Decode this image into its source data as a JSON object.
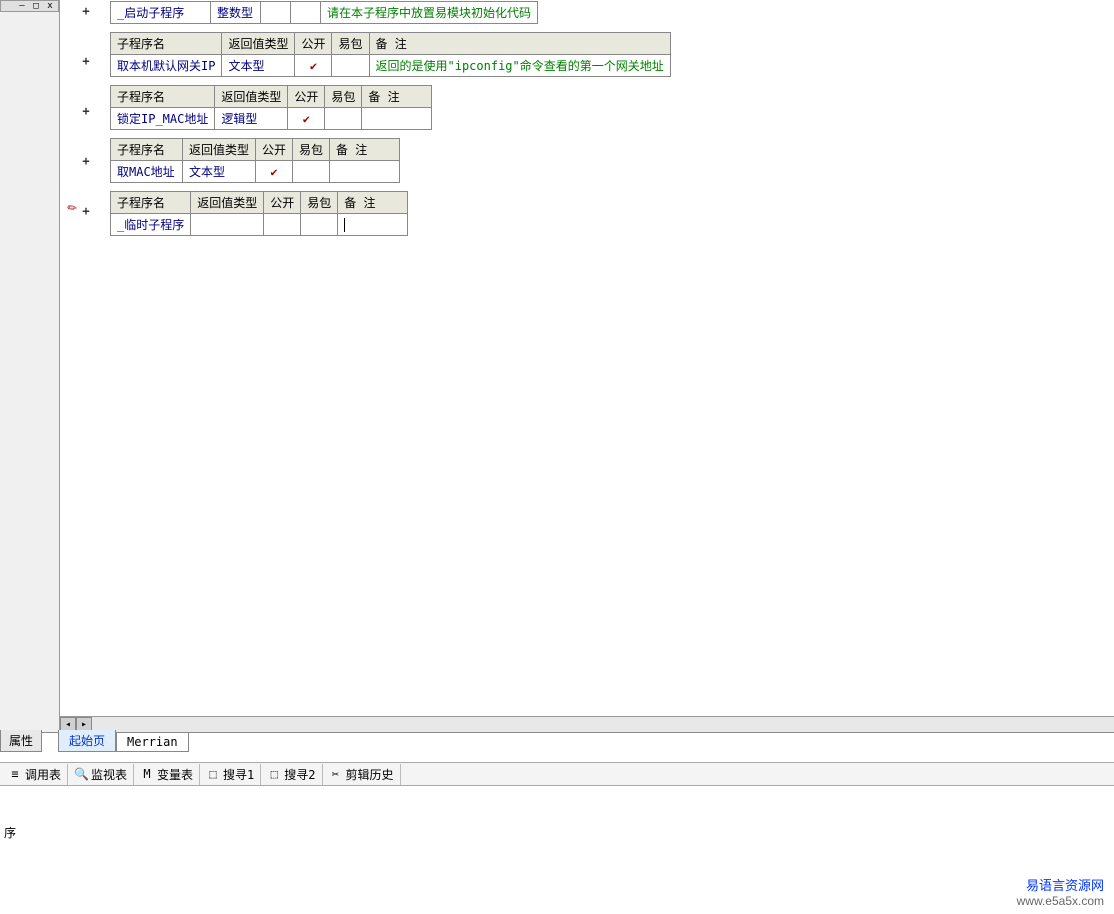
{
  "headers": {
    "name": "子程序名",
    "ret": "返回值类型",
    "pub": "公开",
    "pkg": "易包",
    "note": "备 注"
  },
  "subs": [
    {
      "name": "_启动子程序",
      "ret": "整数型",
      "pub": "",
      "pkg": "",
      "note": "请在本子程序中放置易模块初始化代码"
    },
    {
      "name": "取本机默认网关IP",
      "ret": "文本型",
      "pub": "✓",
      "pkg": "",
      "note": "返回的是使用\"ipconfig\"命令查看的第一个网关地址"
    },
    {
      "name": "锁定IP_MAC地址",
      "ret": "逻辑型",
      "pub": "✓",
      "pkg": "",
      "note": ""
    },
    {
      "name": "取MAC地址",
      "ret": "文本型",
      "pub": "✓",
      "pkg": "",
      "note": ""
    },
    {
      "name": "_临时子程序",
      "ret": "",
      "pub": "",
      "pkg": "",
      "note": "|"
    }
  ],
  "tabs": {
    "prop": "属性",
    "start": "起始页",
    "merrian": "Merrian"
  },
  "tools": [
    {
      "icon": "≡",
      "label": "调用表"
    },
    {
      "icon": "🔍",
      "label": "监视表"
    },
    {
      "icon": "M",
      "label": "变量表"
    },
    {
      "icon": "⬚",
      "label": "搜寻1"
    },
    {
      "icon": "⬚",
      "label": "搜寻2"
    },
    {
      "icon": "✂",
      "label": "剪辑历史"
    }
  ],
  "status": "序",
  "watermark": {
    "cn": "易语言资源网",
    "url": "www.e5a5x.com"
  },
  "window_buttons": {
    "min": "―",
    "max": "□",
    "close": "x"
  }
}
